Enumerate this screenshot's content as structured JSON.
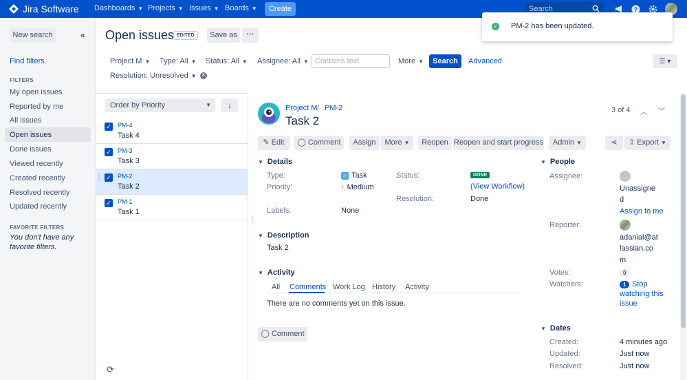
{
  "topnav": {
    "brand": "Jira Software",
    "items": [
      {
        "label": "Dashboards"
      },
      {
        "label": "Projects"
      },
      {
        "label": "Issues"
      },
      {
        "label": "Boards"
      }
    ],
    "create_label": "Create",
    "search_placeholder": "Search",
    "bg_color": "#0052cc"
  },
  "toast": {
    "message": "PM-2 has been updated."
  },
  "sidebar": {
    "new_search": "New search",
    "find_filters": "Find filters",
    "filters_heading": "FILTERS",
    "filters": [
      {
        "label": "My open issues"
      },
      {
        "label": "Reported by me"
      },
      {
        "label": "All issues"
      },
      {
        "label": "Open issues",
        "active": true
      },
      {
        "label": "Done issues"
      },
      {
        "label": "Viewed recently"
      },
      {
        "label": "Created recently"
      },
      {
        "label": "Resolved recently"
      },
      {
        "label": "Updated recently"
      }
    ],
    "favorite_heading": "FAVORITE FILTERS",
    "favorite_empty_1": "You don't have any",
    "favorite_empty_2": "favorite filters."
  },
  "header": {
    "title": "Open issues",
    "edited_badge": "EDITED",
    "save_as": "Save as",
    "more_dots": "···"
  },
  "filterbar": {
    "project": "Project M",
    "type": "Type: All",
    "status": "Status: All",
    "assignee": "Assignee: All",
    "contains_placeholder": "Contains text",
    "more": "More",
    "search": "Search",
    "advanced": "Advanced",
    "resolution": "Resolution: Unresolved"
  },
  "list": {
    "order_by": "Order by Priority",
    "issues": [
      {
        "key": "PM-4",
        "summary": "Task 4",
        "selected": false
      },
      {
        "key": "PM-3",
        "summary": "Task 3",
        "selected": false
      },
      {
        "key": "PM-2",
        "summary": "Task 2",
        "selected": true
      },
      {
        "key": "PM-1",
        "summary": "Task 1",
        "selected": false
      }
    ]
  },
  "detail": {
    "project": "Project M",
    "key": "PM-2",
    "title": "Task 2",
    "pager": "3 of 4",
    "toolbar": {
      "edit": "Edit",
      "comment": "Comment",
      "assign": "Assign",
      "more": "More",
      "reopen": "Reopen",
      "reopen_start": "Reopen and start progress",
      "admin": "Admin",
      "export": "Export"
    },
    "details": {
      "heading": "Details",
      "type_label": "Type:",
      "type_value": "Task",
      "priority_label": "Priority:",
      "priority_value": "Medium",
      "labels_label": "Labels:",
      "labels_value": "None",
      "status_label": "Status:",
      "status_value": "DONE",
      "view_workflow": "(View Workflow)",
      "resolution_label": "Resolution:",
      "resolution_value": "Done"
    },
    "description": {
      "heading": "Description",
      "text": "Task 2"
    },
    "activity": {
      "heading": "Activity",
      "tabs": [
        {
          "label": "All"
        },
        {
          "label": "Comments",
          "active": true
        },
        {
          "label": "Work Log"
        },
        {
          "label": "History"
        },
        {
          "label": "Activity"
        }
      ],
      "empty": "There are no comments yet on this issue.",
      "comment_button": "Comment"
    },
    "people": {
      "heading": "People",
      "assignee_label": "Assignee:",
      "assignee_line1": "Unassigne",
      "assignee_line2": "d",
      "assign_to_me": "Assign to me",
      "reporter_label": "Reporter:",
      "reporter_line1": "adanial@at",
      "reporter_line2": "lassian.co",
      "reporter_line3": "m",
      "votes_label": "Votes:",
      "votes_count": "0",
      "watchers_label": "Watchers:",
      "watchers_count": "1",
      "stop_line1": "Stop",
      "stop_line2": "watching this",
      "stop_line3": "issue"
    },
    "dates": {
      "heading": "Dates",
      "created_label": "Created:",
      "created_value": "4 minutes ago",
      "updated_label": "Updated:",
      "updated_value": "Just now",
      "resolved_label": "Resolved:",
      "resolved_value": "Just now"
    }
  }
}
